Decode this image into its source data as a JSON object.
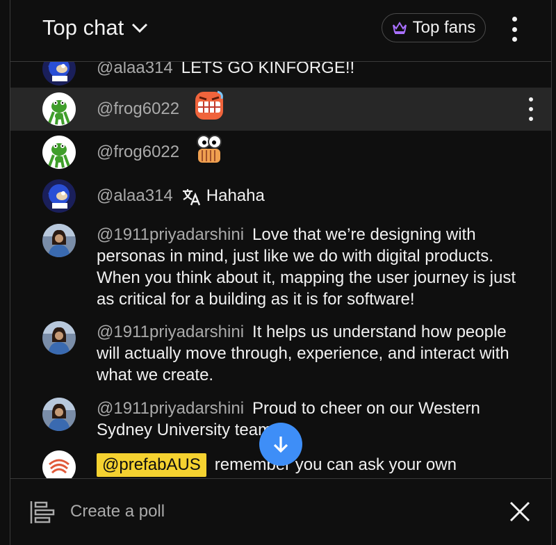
{
  "header": {
    "title": "Top chat",
    "top_fans_label": "Top fans"
  },
  "messages": [
    {
      "author": "@alaa314",
      "text": "LETS GO KINFORGE!!",
      "avatar": "sonic-avatar"
    },
    {
      "author": "@frog6022",
      "text": "",
      "emoji": "grimacing-face-emoji",
      "avatar": "frog-avatar",
      "highlighted": true
    },
    {
      "author": "@frog6022",
      "text": "",
      "emoji": "eyes-hands-emoji",
      "avatar": "frog-avatar"
    },
    {
      "author": "@alaa314",
      "text": "Hahaha",
      "translated": true,
      "avatar": "sonic-avatar"
    },
    {
      "author": "@1911priyadarshini",
      "text": "Love that we’re designing with personas in mind, just like we do with digital products. When you think about it, mapping the user journey is just as critical for a building as it is for software!",
      "avatar": "person-avatar"
    },
    {
      "author": "@1911priyadarshini",
      "text": "It helps us understand how people will actually move through, experience, and interact with what we create.",
      "avatar": "person-avatar"
    },
    {
      "author": "@1911priyadarshini",
      "text": "Proud to cheer on our Western Sydney University team",
      "avatar": "person-avatar"
    },
    {
      "author": "@prefabAUS",
      "text": "remember you can ask your own",
      "avatar": "prefab-logo-avatar",
      "owner_badge": true
    }
  ],
  "footer": {
    "poll_label": "Create a poll"
  },
  "colors": {
    "background": "#0f0f0f",
    "highlight_row": "#272727",
    "author": "#aaaaaa",
    "owner_badge": "#f5d230",
    "scroll_button": "#3e8ef7",
    "crown": "#a970ff"
  }
}
